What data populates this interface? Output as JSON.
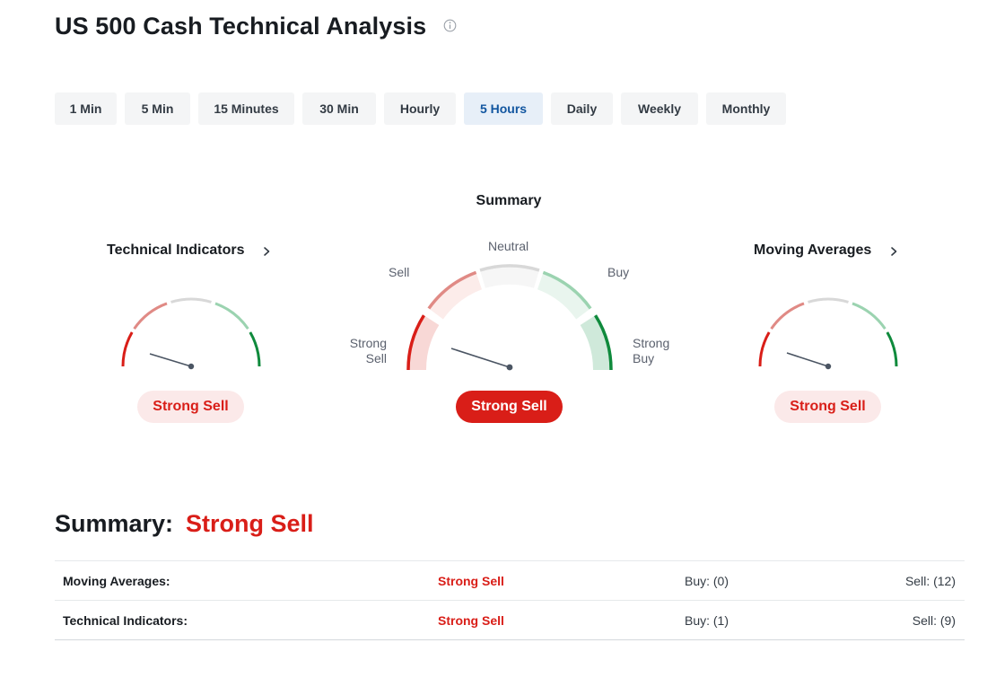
{
  "page": {
    "title": "US 500 Cash Technical Analysis"
  },
  "icons": {
    "info": "info-icon",
    "chevron": "chevron-right-icon"
  },
  "timeframes": [
    {
      "label": "1 Min",
      "active": false
    },
    {
      "label": "5 Min",
      "active": false
    },
    {
      "label": "15 Minutes",
      "active": false
    },
    {
      "label": "30 Min",
      "active": false
    },
    {
      "label": "Hourly",
      "active": false
    },
    {
      "label": "5 Hours",
      "active": true
    },
    {
      "label": "Daily",
      "active": false
    },
    {
      "label": "Weekly",
      "active": false
    },
    {
      "label": "Monthly",
      "active": false
    }
  ],
  "gauges": {
    "technical_indicators": {
      "title": "Technical Indicators",
      "signal": "Strong Sell"
    },
    "summary": {
      "title": "Summary",
      "signal": "Strong Sell",
      "scale_labels": {
        "strong_sell": "Strong Sell",
        "sell": "Sell",
        "neutral": "Neutral",
        "buy": "Buy",
        "strong_buy": "Strong Buy"
      }
    },
    "moving_averages": {
      "title": "Moving Averages",
      "signal": "Strong Sell"
    }
  },
  "summary": {
    "label": "Summary:",
    "value": "Strong Sell",
    "rows": [
      {
        "name": "Moving Averages:",
        "signal": "Strong Sell",
        "buy": "Buy: (0)",
        "sell": "Sell: (12)"
      },
      {
        "name": "Technical Indicators:",
        "signal": "Strong Sell",
        "buy": "Buy: (1)",
        "sell": "Sell: (9)"
      }
    ]
  },
  "colors": {
    "strong_sell": "#d91e18",
    "sell": "#e08a85",
    "neutral": "#d8d8d8",
    "buy": "#9bd3b0",
    "strong_buy": "#0f8a3c",
    "active_tab_text": "#1256a0"
  }
}
